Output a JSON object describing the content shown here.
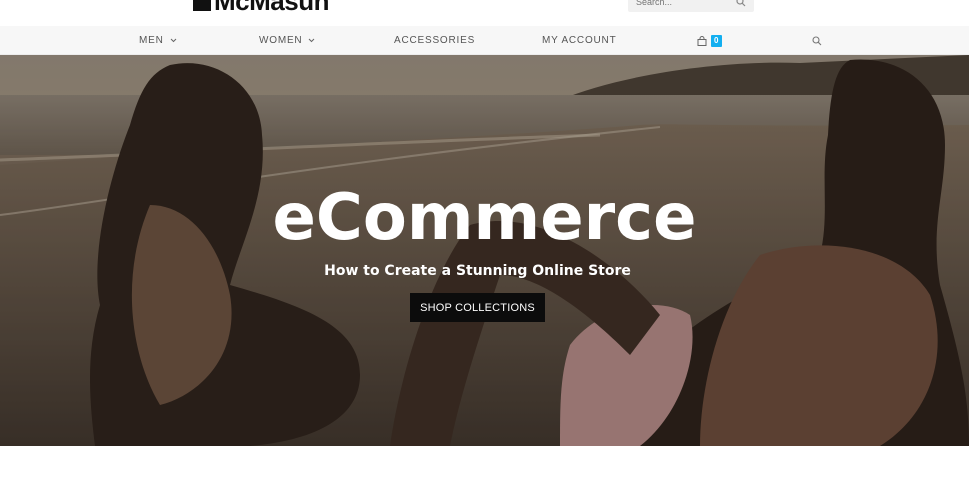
{
  "header": {
    "logo_text": "McMasun",
    "search_placeholder": "Search..."
  },
  "nav": {
    "men": "MEN",
    "women": "WOMEN",
    "accessories": "ACCESSORIES",
    "my_account": "MY ACCOUNT",
    "cart_count": "0"
  },
  "hero": {
    "title": "eCommerce",
    "subtitle": "How to Create a Stunning Online Store",
    "button_label": "SHOP COLLECTIONS"
  },
  "colors": {
    "accent": "#13aff0",
    "button_bg": "#0c0c0c",
    "nav_bg": "#f7f7f7"
  }
}
